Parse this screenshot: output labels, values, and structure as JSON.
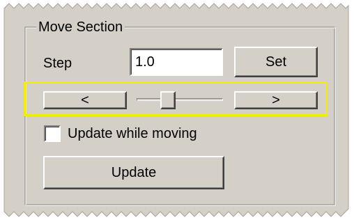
{
  "panel": {
    "title": "Move Section"
  },
  "step": {
    "label": "Step",
    "value": "1.0",
    "set_button_label": "Set"
  },
  "navigator": {
    "prev_label": "<",
    "next_label": ">",
    "slider_position": 0.33
  },
  "options": {
    "update_while_moving_label": "Update while moving",
    "update_while_moving_checked": false
  },
  "actions": {
    "update_button_label": "Update"
  },
  "colors": {
    "panel_background": "#d4d0c8",
    "highlight_border": "#f2ec00"
  }
}
